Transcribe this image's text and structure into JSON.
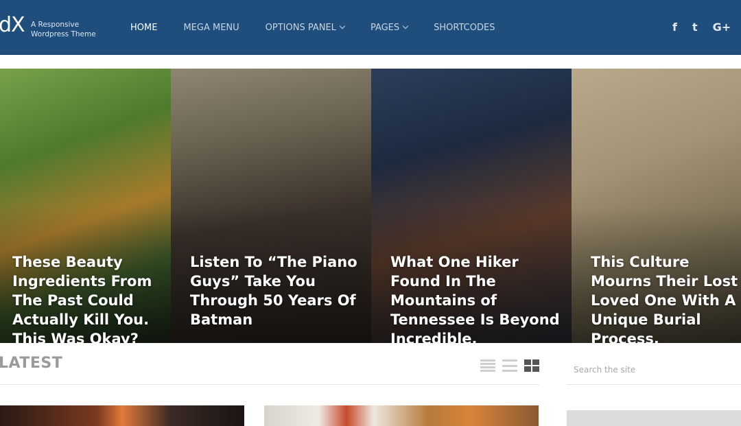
{
  "header": {
    "logo_text": "dX",
    "tagline_line1": "A Responsive",
    "tagline_line2": "Wordpress Theme",
    "nav": [
      {
        "label": "HOME",
        "active": true,
        "dropdown": false
      },
      {
        "label": "MEGA MENU",
        "active": false,
        "dropdown": false
      },
      {
        "label": "OPTIONS PANEL",
        "active": false,
        "dropdown": true
      },
      {
        "label": "PAGES",
        "active": false,
        "dropdown": true
      },
      {
        "label": "SHORTCODES",
        "active": false,
        "dropdown": false
      }
    ],
    "social": [
      {
        "icon": "facebook-icon",
        "glyph": "f"
      },
      {
        "icon": "twitter-icon",
        "glyph": "t"
      },
      {
        "icon": "google-plus-icon",
        "glyph": "G+"
      }
    ],
    "background_color": "#1f4e7c"
  },
  "slider": {
    "slides": [
      {
        "title": "These Beauty Ingredients From The Past Could Actually Kill You. This Was Okay?"
      },
      {
        "title": "Listen To “The Piano Guys” Take You Through 50 Years Of Batman"
      },
      {
        "title": "What One Hiker Found In The Mountains of Tennessee Is Beyond Incredible."
      },
      {
        "title": "This Culture Mourns Their Lost Loved One With A Unique Burial Process."
      }
    ]
  },
  "section": {
    "title": "LATEST",
    "views": [
      "list-view-icon",
      "compact-list-view-icon",
      "grid-view-icon"
    ],
    "active_view": "grid-view-icon"
  },
  "search": {
    "placeholder": "Search the site"
  }
}
